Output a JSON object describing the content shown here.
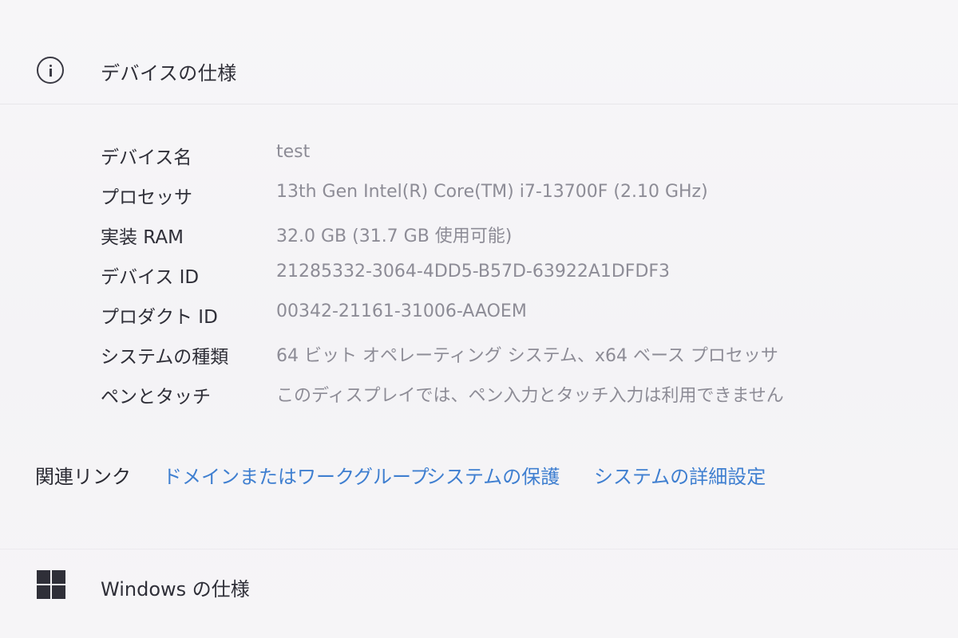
{
  "device_specs": {
    "title": "デバイスの仕様",
    "icon": "info-icon",
    "rows": [
      {
        "label": "デバイス名",
        "value": "test"
      },
      {
        "label": "プロセッサ",
        "value": "13th Gen Intel(R) Core(TM) i7-13700F (2.10 GHz)"
      },
      {
        "label": "実装 RAM",
        "value": "32.0 GB (31.7 GB 使用可能)"
      },
      {
        "label": "デバイス ID",
        "value": "21285332-3064-4DD5-B57D-63922A1DFDF3"
      },
      {
        "label": "プロダクト ID",
        "value": "00342-21161-31006-AAOEM"
      },
      {
        "label": "システムの種類",
        "value": "64 ビット オペレーティング システム、x64 ベース プロセッサ"
      },
      {
        "label": "ペンとタッチ",
        "value": "このディスプレイでは、ペン入力とタッチ入力は利用できません"
      }
    ]
  },
  "related_links": {
    "label": "関連リンク",
    "links": [
      {
        "label": "ドメインまたはワークグループ"
      },
      {
        "label": "システムの保護"
      },
      {
        "label": "システムの詳細設定"
      }
    ]
  },
  "windows_specs": {
    "title": "Windows の仕様",
    "icon": "windows-logo-icon"
  },
  "colors": {
    "link": "#3f7fd0",
    "value_text": "#8d8c96",
    "label_text": "#2f2f38",
    "background": "#f6f5f7"
  }
}
